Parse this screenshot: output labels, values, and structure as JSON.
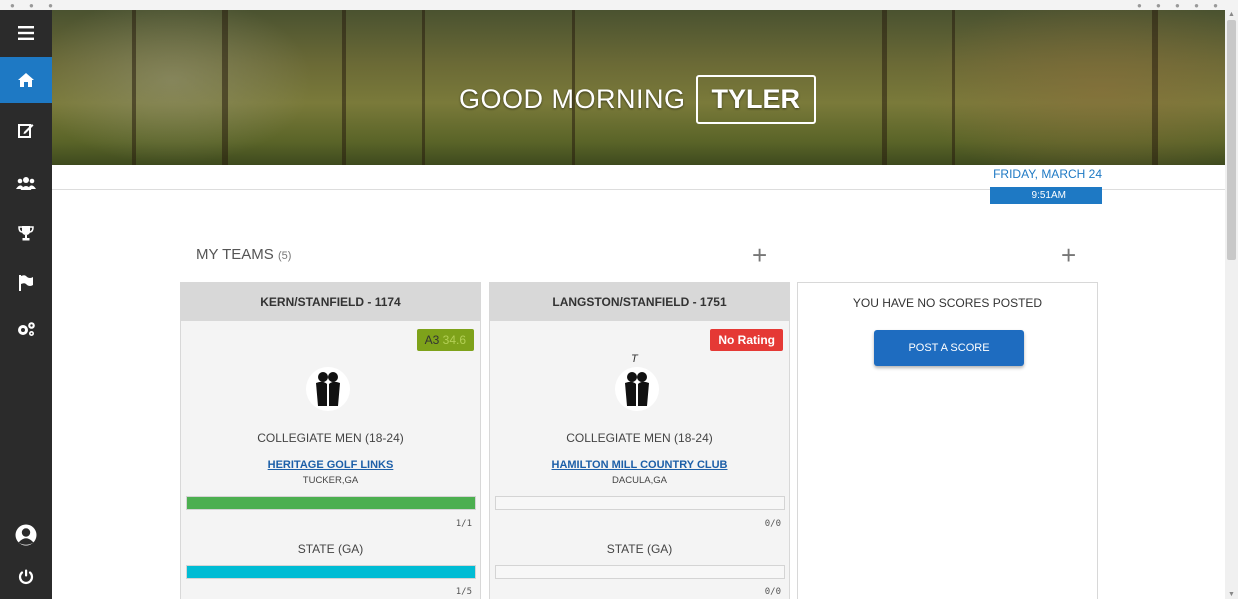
{
  "hero": {
    "greeting": "GOOD MORNING",
    "name": "TYLER"
  },
  "datetime": {
    "date": "FRIDAY, MARCH 24",
    "time": "9:51AM"
  },
  "sidebar": {
    "items": [
      {
        "icon": "hamburger-icon"
      },
      {
        "icon": "home-icon",
        "active": true
      },
      {
        "icon": "edit-icon"
      },
      {
        "icon": "users-icon"
      },
      {
        "icon": "trophy-icon"
      },
      {
        "icon": "flag-icon"
      },
      {
        "icon": "settings-icon"
      },
      {
        "icon": "profile-icon"
      },
      {
        "icon": "power-icon"
      }
    ]
  },
  "teams": {
    "title": "MY TEAMS",
    "count": "(5)",
    "cards": [
      {
        "name": "KERN/STANFIELD - 1174",
        "rating_main": "A3",
        "rating_sub": "34.6",
        "division": "COLLEGIATE MEN (18-24)",
        "course": "HERITAGE GOLF LINKS",
        "city": "TUCKER,GA",
        "bar1_fraction": 1.0,
        "bar1_count": "1/1",
        "state": "STATE (GA)",
        "bar2_fraction": 1.0,
        "bar2_count": "1/5"
      },
      {
        "name": "LANGSTON/STANFIELD - 1751",
        "rating": "No Rating",
        "t_mark": "T",
        "division": "COLLEGIATE MEN (18-24)",
        "course": "HAMILTON MILL COUNTRY CLUB",
        "city": "DACULA,GA",
        "bar1_fraction": 0,
        "bar1_count": "0/0",
        "state": "STATE (GA)",
        "bar2_fraction": 0,
        "bar2_count": "0/0"
      }
    ]
  },
  "scores": {
    "message": "YOU HAVE NO SCORES POSTED",
    "post_label": "POST A SCORE"
  },
  "colors": {
    "accent": "#1e79c4",
    "sidebar": "#2b2b2b",
    "bar_green": "#4caf50",
    "bar_cyan": "#00bcd4",
    "rating_green": "#7ea21a",
    "rating_red": "#e53935"
  }
}
